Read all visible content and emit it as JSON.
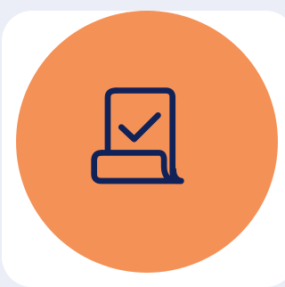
{
  "badge": {
    "icon": "document-check-icon",
    "background_color": "#f49157",
    "icon_color": "#112258"
  }
}
